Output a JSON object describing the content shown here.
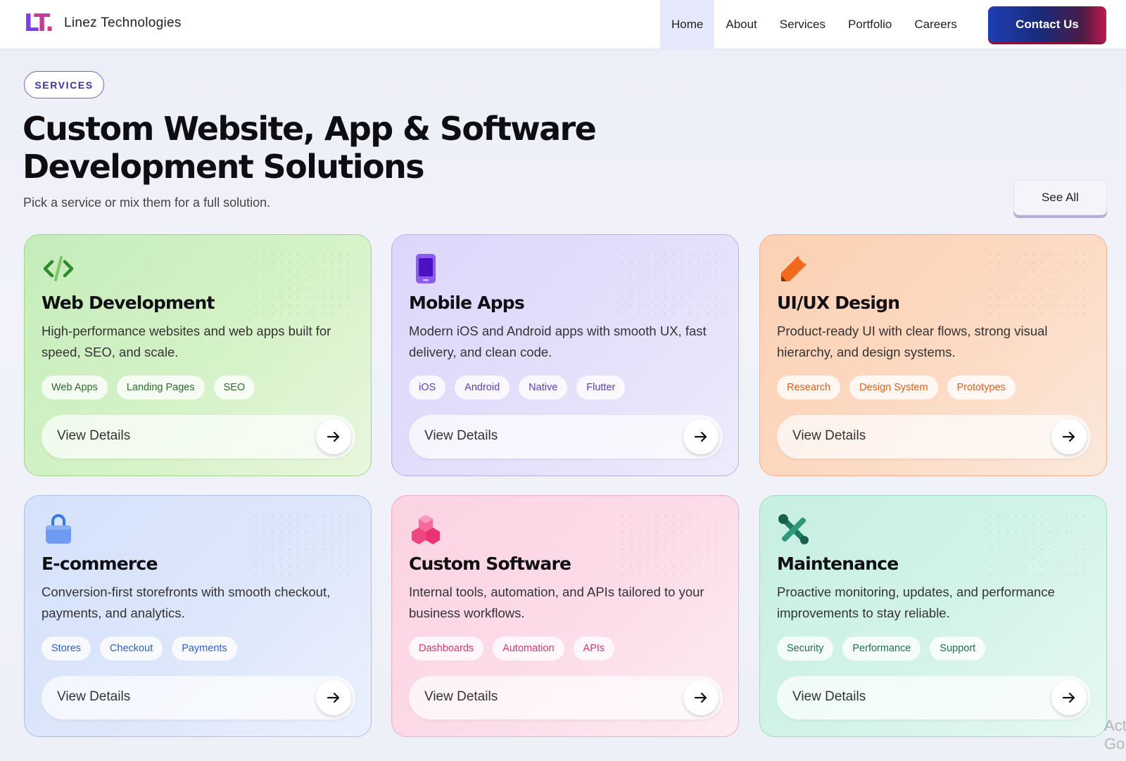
{
  "nav": {
    "logo_mark": "LT.",
    "logo_text": "Linez Technologies",
    "items": [
      {
        "label": "Home",
        "active": true
      },
      {
        "label": "About",
        "active": false
      },
      {
        "label": "Services",
        "active": false
      },
      {
        "label": "Portfolio",
        "active": false
      },
      {
        "label": "Careers",
        "active": false
      }
    ],
    "contact_label": "Contact Us"
  },
  "hero": {
    "pill": "SERVICES",
    "title_line1": "Custom Website, App & Software",
    "title_line2": "Development Solutions",
    "subtitle": "Pick a service or mix them for a full solution.",
    "see_all": "See All"
  },
  "cards": [
    {
      "title": "Web Development",
      "icon": "code-icon",
      "desc": "High-performance websites and web apps built for speed, SEO, and scale.",
      "tags": [
        "Web Apps",
        "Landing Pages",
        "SEO"
      ],
      "tag_color": "#2f6b2a",
      "details": "View Details"
    },
    {
      "title": "Mobile Apps",
      "icon": "mobile-phone-icon",
      "desc": "Modern iOS and Android apps with smooth UX, fast delivery, and clean code.",
      "tags": [
        "iOS",
        "Android",
        "Native",
        "Flutter"
      ],
      "tag_color": "#5b3cc4",
      "details": "View Details"
    },
    {
      "title": "UI/UX Design",
      "icon": "pencil-ruler-icon",
      "desc": "Product-ready UI with clear flows, strong visual hierarchy, and design systems.",
      "tags": [
        "Research",
        "Design System",
        "Prototypes"
      ],
      "tag_color": "#e0601c",
      "details": "View Details"
    },
    {
      "title": "E-commerce",
      "icon": "shopping-bag-icon",
      "desc": "Conversion-first storefronts with smooth checkout, payments, and analytics.",
      "tags": [
        "Stores",
        "Checkout",
        "Payments"
      ],
      "tag_color": "#2d5bd0",
      "details": "View Details"
    },
    {
      "title": "Custom Software",
      "icon": "cubes-icon",
      "desc": "Internal tools, automation, and APIs tailored to your business workflows.",
      "tags": [
        "Dashboards",
        "Automation",
        "APIs"
      ],
      "tag_color": "#e0336f",
      "details": "View Details"
    },
    {
      "title": "Maintenance",
      "icon": "tools-icon",
      "desc": "Proactive monitoring, updates, and performance improvements to stay reliable.",
      "tags": [
        "Security",
        "Performance",
        "Support"
      ],
      "tag_color": "#1f6e57",
      "details": "View Details"
    }
  ],
  "colors": {
    "brand_purple": "#7b3fe4",
    "brand_pink": "#d23d7d",
    "contact_gradient_start": "#1d3fb3",
    "contact_gradient_end": "#c2184f"
  },
  "watermark": {
    "line1": "Act",
    "line2": "Go"
  }
}
